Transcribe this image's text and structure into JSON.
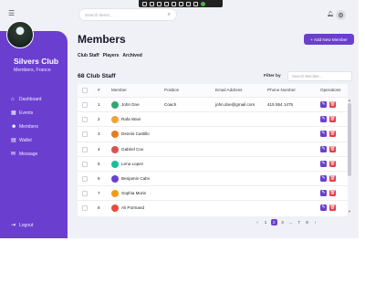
{
  "header": {
    "search_placeholder": "Search items...",
    "icons": [
      "search-icon",
      "bell-icon",
      "gear-icon",
      "hamburger-icon"
    ]
  },
  "sidebar": {
    "club_name": "Silvers Club",
    "club_location": "Members, France",
    "items": [
      {
        "label": "Dashboard",
        "icon": "home-icon",
        "glyph": "⌂"
      },
      {
        "label": "Events",
        "icon": "calendar-icon",
        "glyph": "▦"
      },
      {
        "label": "Members",
        "icon": "users-icon",
        "glyph": "☻"
      },
      {
        "label": "Wallet",
        "icon": "wallet-icon",
        "glyph": "▤"
      },
      {
        "label": "Message",
        "icon": "message-icon",
        "glyph": "✉"
      }
    ],
    "logout_label": "Logout"
  },
  "main": {
    "title": "Members",
    "add_button_label": "+ Add New Member",
    "tabs": [
      "Club Staff",
      "Players",
      "Archived"
    ],
    "section_title": "68 Club Staff",
    "filter_label": "Filter by",
    "filter_placeholder": "Search Member...",
    "accent_color": "#6a3fcf",
    "danger_color": "#e23c4f"
  },
  "table": {
    "columns": [
      "#",
      "Member",
      "Position",
      "Email Address",
      "Phone Number",
      "Operations"
    ],
    "rows": [
      {
        "num": "1",
        "name": "John Doe",
        "position": "Coach",
        "email": "john.doe@gmail.com",
        "phone": "415 554 1475",
        "avatar_color": "#2fa872"
      },
      {
        "num": "2",
        "name": "Rafa Wavi",
        "position": "",
        "email": "",
        "phone": "",
        "avatar_color": "#f2a13a"
      },
      {
        "num": "3",
        "name": "Dennis Castillo",
        "position": "",
        "email": "",
        "phone": "",
        "avatar_color": "#e67e22"
      },
      {
        "num": "4",
        "name": "Gabriel Cox",
        "position": "",
        "email": "",
        "phone": "",
        "avatar_color": "#d9534f"
      },
      {
        "num": "5",
        "name": "Lena Lopez",
        "position": "",
        "email": "",
        "phone": "",
        "avatar_color": "#1abc9c"
      },
      {
        "num": "6",
        "name": "Benjamin Cabv",
        "position": "",
        "email": "",
        "phone": "",
        "avatar_color": "#6a3fcf"
      },
      {
        "num": "7",
        "name": "Sophia Murie",
        "position": "",
        "email": "",
        "phone": "",
        "avatar_color": "#f39c12"
      },
      {
        "num": "8",
        "name": "Ali Pormand",
        "position": "",
        "email": "",
        "phone": "",
        "avatar_color": "#e74c3c"
      }
    ]
  },
  "pagination": {
    "pages": [
      "‹",
      "1",
      "2",
      "3",
      "...",
      "7",
      "8",
      "›"
    ],
    "active": "2"
  }
}
